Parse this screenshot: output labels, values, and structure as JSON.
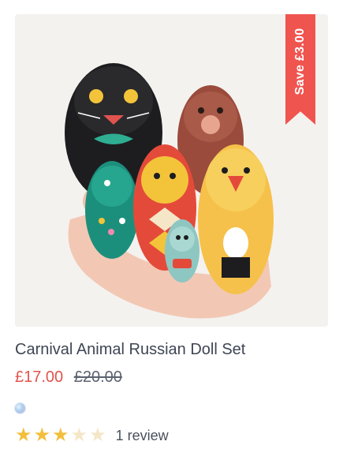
{
  "product": {
    "title": "Carnival Animal Russian Doll Set",
    "image_alt": "Hand holding a set of colourful animal nesting dolls",
    "badge": {
      "label": "Save £3.00",
      "color": "#f0544f"
    },
    "price": {
      "sale": "£17.00",
      "original": "£20.00",
      "sale_color": "#e0534e"
    },
    "swatches": [
      {
        "name": "multicolour",
        "icon": "color-swatch-dot"
      }
    ],
    "rating": {
      "value": 3,
      "max": 5,
      "stars": [
        "★",
        "★",
        "★",
        "★",
        "★"
      ],
      "filled_color": "#f2bf3c",
      "empty_color": "#f4e7c8",
      "review_text": "1 review"
    }
  }
}
